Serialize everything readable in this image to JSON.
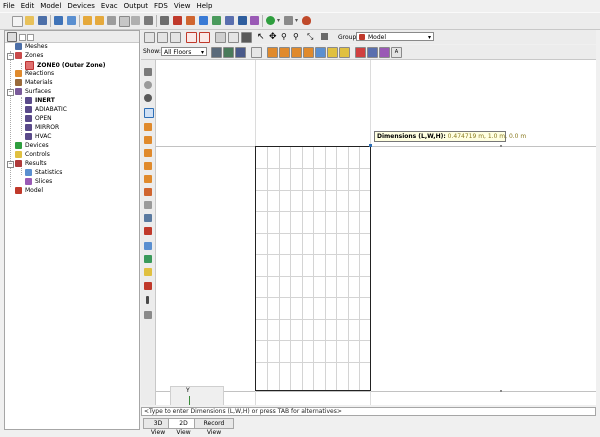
{
  "menu": [
    "File",
    "Edit",
    "Model",
    "Devices",
    "Evac",
    "Output",
    "FDS",
    "View",
    "Help"
  ],
  "navigator": {
    "items": [
      {
        "label": "Meshes",
        "bold": false
      },
      {
        "label": "Zones",
        "bold": false
      },
      {
        "label": "ZONE0 (Outer Zone)",
        "bold": true
      },
      {
        "label": "Reactions",
        "bold": false
      },
      {
        "label": "Materials",
        "bold": false
      },
      {
        "label": "Surfaces",
        "bold": false
      },
      {
        "label": "INERT",
        "bold": true
      },
      {
        "label": "ADIABATIC",
        "bold": false
      },
      {
        "label": "OPEN",
        "bold": false
      },
      {
        "label": "MIRROR",
        "bold": false
      },
      {
        "label": "HVAC",
        "bold": false
      },
      {
        "label": "Devices",
        "bold": false
      },
      {
        "label": "Controls",
        "bold": false
      },
      {
        "label": "Results",
        "bold": false
      },
      {
        "label": "Statistics",
        "bold": false
      },
      {
        "label": "Slices",
        "bold": false
      },
      {
        "label": "Model",
        "bold": false
      }
    ]
  },
  "view_toolbar": {
    "group_label": "Group:",
    "group_value": "Model",
    "show_label": "Show:",
    "show_value": "All Floors"
  },
  "tooltip": {
    "label": "Dimensions (L,W,H):",
    "value": "0.474719 m, 1.0 m, 0.0 m"
  },
  "command_line": "<Type to enter Dimensions (L,W,H) or press TAB for alternatives>",
  "axis": {
    "y": "Y",
    "x": "X"
  },
  "tabs": [
    "3D View",
    "2D View",
    "Record View"
  ],
  "active_tab": "2D View",
  "colors": {
    "accent_red": "#c0392b",
    "accent_orange": "#e08a2c",
    "accent_blue": "#2e6fb6",
    "accent_green": "#2e9e3e",
    "tooltip_bg": "#ffffe1"
  }
}
